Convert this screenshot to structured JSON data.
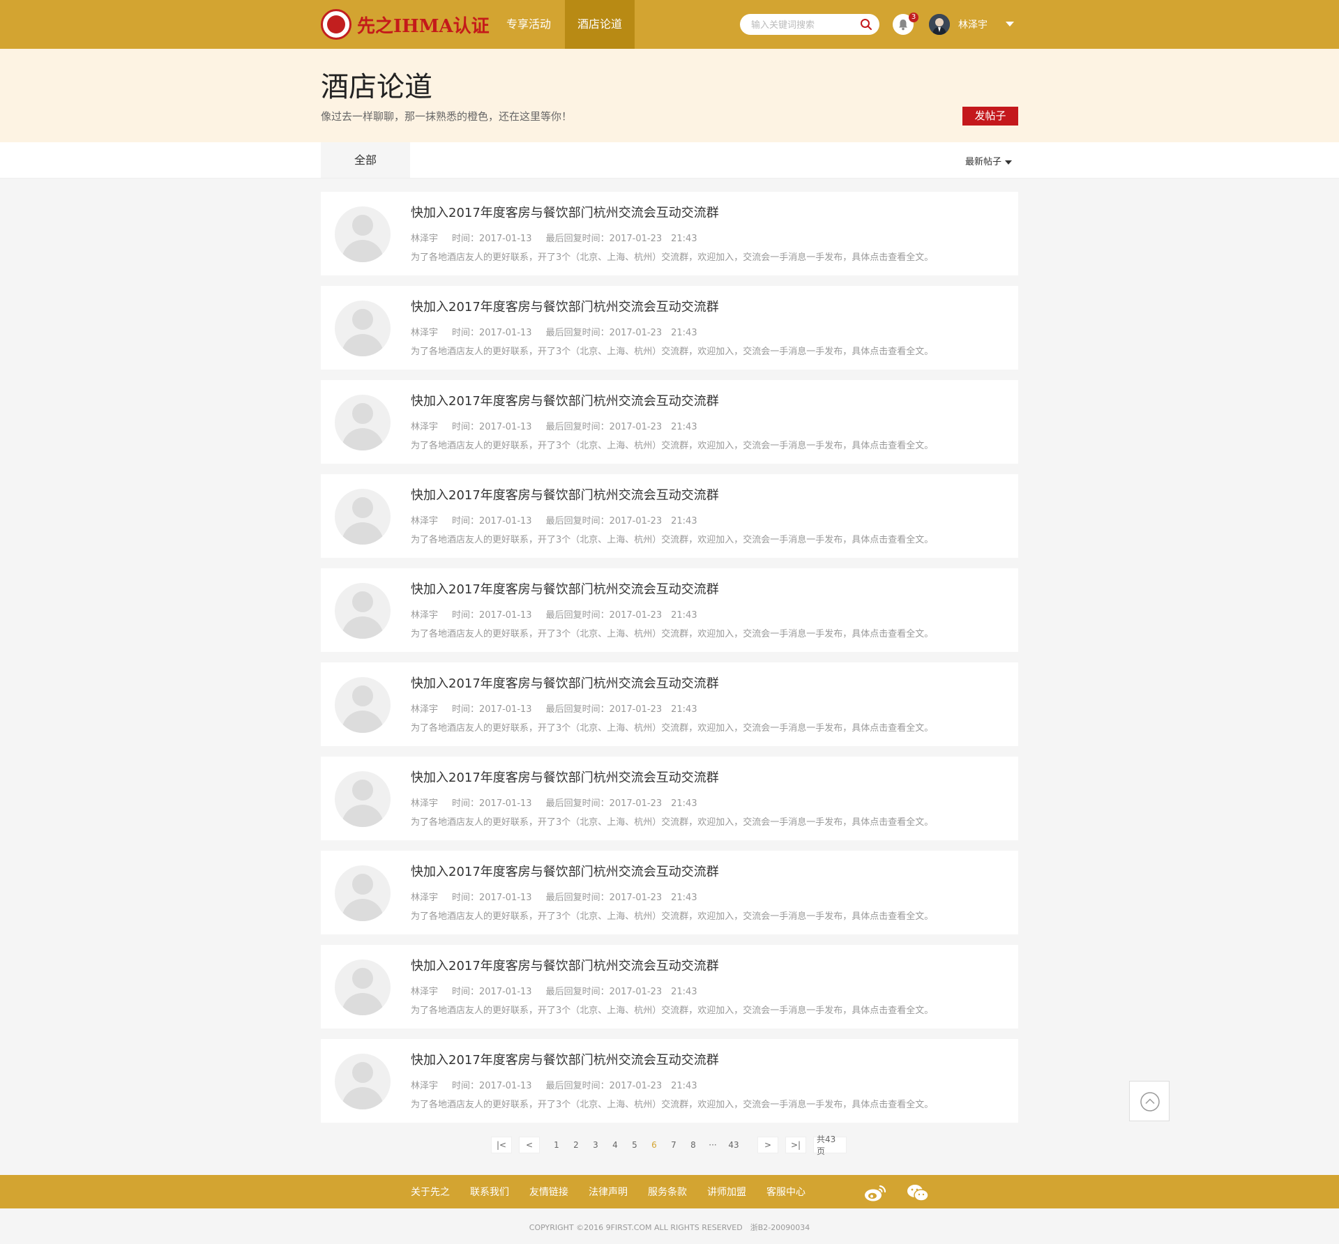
{
  "header": {
    "logo_text": "先之IHMA认证",
    "nav": [
      "专享活动",
      "酒店论道"
    ],
    "search_placeholder": "输入关键词搜索",
    "notification_count": "3",
    "user_name": "林泽宇"
  },
  "banner": {
    "title": "酒店论道",
    "subtitle": "像过去一样聊聊，那一抹熟悉的橙色，还在这里等你！",
    "post_button": "发帖子"
  },
  "tabs": {
    "all": "全部",
    "sort": "最新帖子"
  },
  "posts": [
    {
      "title": "快加入2017年度客房与餐饮部门杭州交流会互动交流群",
      "author": "林泽宇",
      "time": "时间：2017-01-13",
      "last_reply": "最后回复时间：2017-01-23　21:43",
      "desc": "为了各地酒店友人的更好联系，开了3个（北京、上海、杭州）交流群，欢迎加入，交流会一手消息一手发布，具体点击查看全文。"
    },
    {
      "title": "快加入2017年度客房与餐饮部门杭州交流会互动交流群",
      "author": "林泽宇",
      "time": "时间：2017-01-13",
      "last_reply": "最后回复时间：2017-01-23　21:43",
      "desc": "为了各地酒店友人的更好联系，开了3个（北京、上海、杭州）交流群，欢迎加入，交流会一手消息一手发布，具体点击查看全文。"
    },
    {
      "title": "快加入2017年度客房与餐饮部门杭州交流会互动交流群",
      "author": "林泽宇",
      "time": "时间：2017-01-13",
      "last_reply": "最后回复时间：2017-01-23　21:43",
      "desc": "为了各地酒店友人的更好联系，开了3个（北京、上海、杭州）交流群，欢迎加入，交流会一手消息一手发布，具体点击查看全文。"
    },
    {
      "title": "快加入2017年度客房与餐饮部门杭州交流会互动交流群",
      "author": "林泽宇",
      "time": "时间：2017-01-13",
      "last_reply": "最后回复时间：2017-01-23　21:43",
      "desc": "为了各地酒店友人的更好联系，开了3个（北京、上海、杭州）交流群，欢迎加入，交流会一手消息一手发布，具体点击查看全文。"
    },
    {
      "title": "快加入2017年度客房与餐饮部门杭州交流会互动交流群",
      "author": "林泽宇",
      "time": "时间：2017-01-13",
      "last_reply": "最后回复时间：2017-01-23　21:43",
      "desc": "为了各地酒店友人的更好联系，开了3个（北京、上海、杭州）交流群，欢迎加入，交流会一手消息一手发布，具体点击查看全文。"
    },
    {
      "title": "快加入2017年度客房与餐饮部门杭州交流会互动交流群",
      "author": "林泽宇",
      "time": "时间：2017-01-13",
      "last_reply": "最后回复时间：2017-01-23　21:43",
      "desc": "为了各地酒店友人的更好联系，开了3个（北京、上海、杭州）交流群，欢迎加入，交流会一手消息一手发布，具体点击查看全文。"
    },
    {
      "title": "快加入2017年度客房与餐饮部门杭州交流会互动交流群",
      "author": "林泽宇",
      "time": "时间：2017-01-13",
      "last_reply": "最后回复时间：2017-01-23　21:43",
      "desc": "为了各地酒店友人的更好联系，开了3个（北京、上海、杭州）交流群，欢迎加入，交流会一手消息一手发布，具体点击查看全文。"
    },
    {
      "title": "快加入2017年度客房与餐饮部门杭州交流会互动交流群",
      "author": "林泽宇",
      "time": "时间：2017-01-13",
      "last_reply": "最后回复时间：2017-01-23　21:43",
      "desc": "为了各地酒店友人的更好联系，开了3个（北京、上海、杭州）交流群，欢迎加入，交流会一手消息一手发布，具体点击查看全文。"
    },
    {
      "title": "快加入2017年度客房与餐饮部门杭州交流会互动交流群",
      "author": "林泽宇",
      "time": "时间：2017-01-13",
      "last_reply": "最后回复时间：2017-01-23　21:43",
      "desc": "为了各地酒店友人的更好联系，开了3个（北京、上海、杭州）交流群，欢迎加入，交流会一手消息一手发布，具体点击查看全文。"
    },
    {
      "title": "快加入2017年度客房与餐饮部门杭州交流会互动交流群",
      "author": "林泽宇",
      "time": "时间：2017-01-13",
      "last_reply": "最后回复时间：2017-01-23　21:43",
      "desc": "为了各地酒店友人的更好联系，开了3个（北京、上海、杭州）交流群，欢迎加入，交流会一手消息一手发布，具体点击查看全文。"
    }
  ],
  "pagination": {
    "first": "|<",
    "prev": "<",
    "pages": [
      "1",
      "2",
      "3",
      "4",
      "5",
      "6",
      "7",
      "8"
    ],
    "current": "6",
    "ellipsis": "···",
    "last_page": "43",
    "next": ">",
    "last": ">|",
    "total": "共43页"
  },
  "footer": {
    "links": [
      "关于先之",
      "联系我们",
      "友情链接",
      "法律声明",
      "服务条款",
      "讲师加盟",
      "客服中心"
    ],
    "social_icons": [
      "weibo-icon",
      "wechat-icon"
    ],
    "copyright": "COPYRIGHT ©2016 9FIRST.COM ALL RIGHTS RESERVED　浙B2-20090034"
  },
  "colors": {
    "brand": "#d3a431",
    "nav_active": "#b88a14",
    "banner_bg": "#fdf3e3",
    "button_red": "#c4181c"
  }
}
